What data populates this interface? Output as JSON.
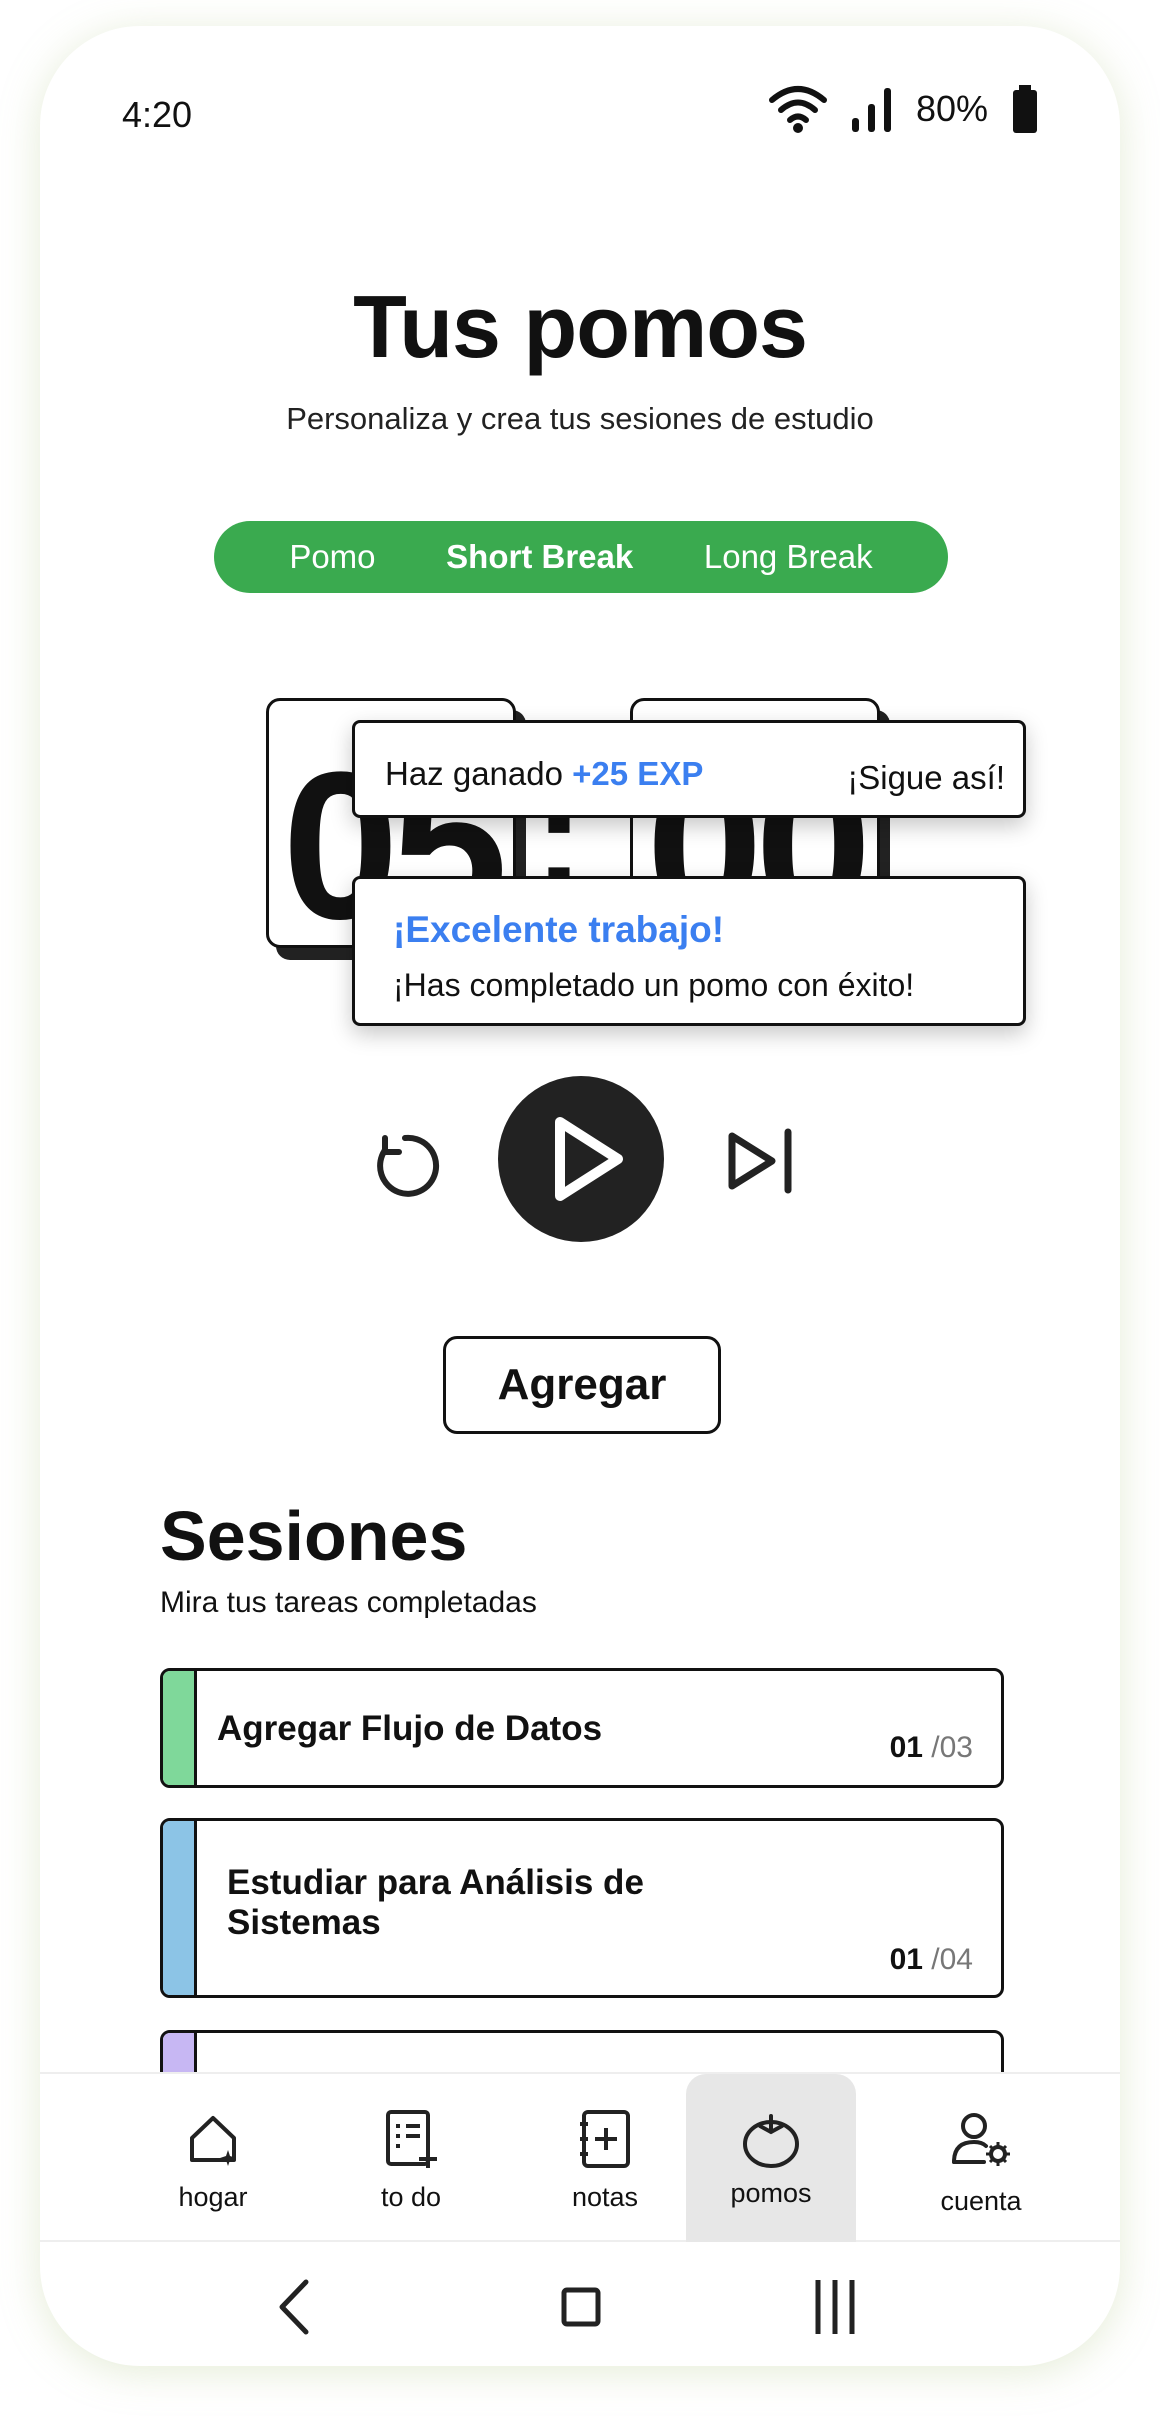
{
  "status_bar": {
    "time": "4:20",
    "battery": "80%"
  },
  "header": {
    "title": "Tus pomos",
    "subtitle": "Personaliza y crea tus sesiones de estudio"
  },
  "mode_tabs": [
    {
      "label": "Pomo",
      "active": false
    },
    {
      "label": "Short Break",
      "active": true
    },
    {
      "label": "Long Break",
      "active": false
    }
  ],
  "timer": {
    "minutes": "05",
    "separator": ":",
    "seconds": "00"
  },
  "toast_exp": {
    "prefix": "Haz ganado",
    "exp": "+25 EXP",
    "right": "¡Sigue así!"
  },
  "toast_ok": {
    "title": "¡Excelente trabajo!",
    "body": "¡Has completado un pomo con éxito!"
  },
  "actions": {
    "add_label": "Agregar"
  },
  "sessions": {
    "title": "Sesiones",
    "subtitle": "Mira tus tareas completadas",
    "items": [
      {
        "name": "Agregar Flujo de Datos",
        "current": "01",
        "total": "/03",
        "color": "#7fd89a"
      },
      {
        "name": "Estudiar para Análisis de Sistemas",
        "current": "01",
        "total": "/04",
        "color": "#8cc4e6"
      },
      {
        "name": "",
        "current": "",
        "total": "",
        "color": "#c7b7f3"
      }
    ]
  },
  "bottom_nav": [
    {
      "label": "hogar",
      "icon": "home-sparkle-icon",
      "active": false
    },
    {
      "label": "to do",
      "icon": "checklist-add-icon",
      "active": false
    },
    {
      "label": "notas",
      "icon": "notebook-add-icon",
      "active": false
    },
    {
      "label": "pomos",
      "icon": "tomato-icon",
      "active": true
    },
    {
      "label": "cuenta",
      "icon": "user-settings-icon",
      "active": false
    }
  ],
  "colors": {
    "accent_green": "#3aaa4f",
    "accent_blue": "#3b7ff0",
    "dark": "#222222"
  }
}
